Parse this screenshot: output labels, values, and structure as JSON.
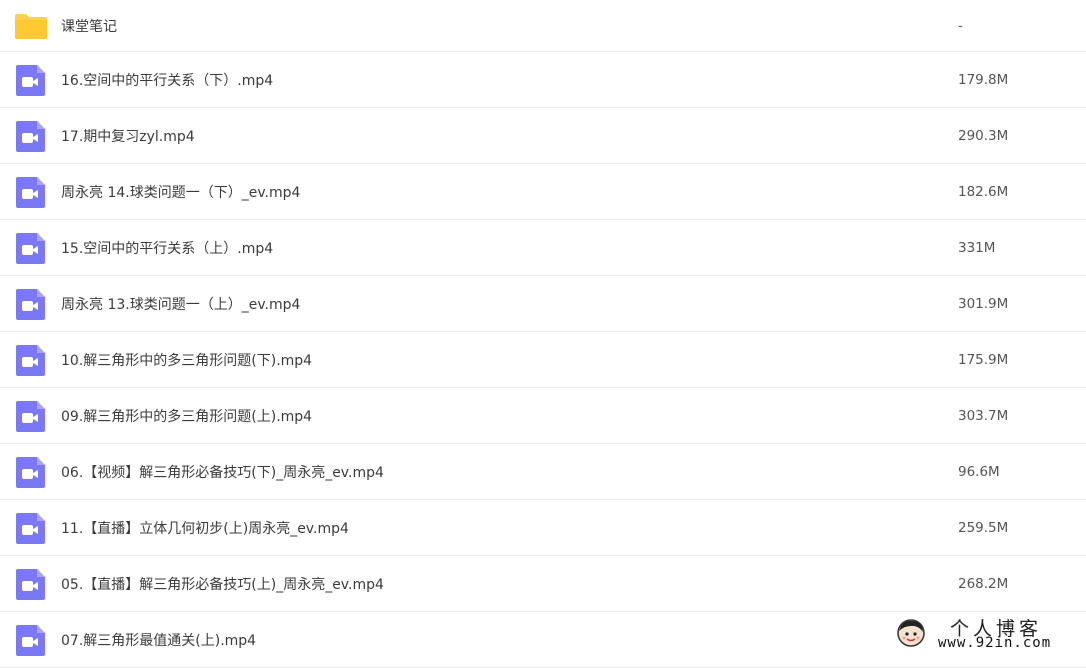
{
  "files": [
    {
      "name": "课堂笔记",
      "size": "-",
      "icon": "folder-icon",
      "color": "#FFD050"
    },
    {
      "name": "16.空间中的平行关系（下）.mp4",
      "size": "179.8M",
      "icon": "video-file-icon",
      "color": "#7B78F4"
    },
    {
      "name": "17.期中复习zyl.mp4",
      "size": "290.3M",
      "icon": "video-file-icon",
      "color": "#7B78F4"
    },
    {
      "name": "周永亮 14.球类问题一（下）_ev.mp4",
      "size": "182.6M",
      "icon": "video-file-icon",
      "color": "#7B78F4"
    },
    {
      "name": "15.空间中的平行关系（上）.mp4",
      "size": "331M",
      "icon": "video-file-icon",
      "color": "#7B78F4"
    },
    {
      "name": "周永亮 13.球类问题一（上）_ev.mp4",
      "size": "301.9M",
      "icon": "video-file-icon",
      "color": "#7B78F4"
    },
    {
      "name": "10.解三角形中的多三角形问题(下).mp4",
      "size": "175.9M",
      "icon": "video-file-icon",
      "color": "#7B78F4"
    },
    {
      "name": "09.解三角形中的多三角形问题(上).mp4",
      "size": "303.7M",
      "icon": "video-file-icon",
      "color": "#7B78F4"
    },
    {
      "name": "06.【视频】解三角形必备技巧(下)_周永亮_ev.mp4",
      "size": "96.6M",
      "icon": "video-file-icon",
      "color": "#7B78F4"
    },
    {
      "name": "11.【直播】立体几何初步(上)周永亮_ev.mp4",
      "size": "259.5M",
      "icon": "video-file-icon",
      "color": "#7B78F4"
    },
    {
      "name": "05.【直播】解三角形必备技巧(上)_周永亮_ev.mp4",
      "size": "268.2M",
      "icon": "video-file-icon",
      "color": "#7B78F4"
    },
    {
      "name": "07.解三角形最值通关(上).mp4",
      "size": "",
      "icon": "video-file-icon",
      "color": "#7B78F4"
    }
  ],
  "watermark": {
    "title": "个人博客",
    "url": "www.92in.com"
  }
}
